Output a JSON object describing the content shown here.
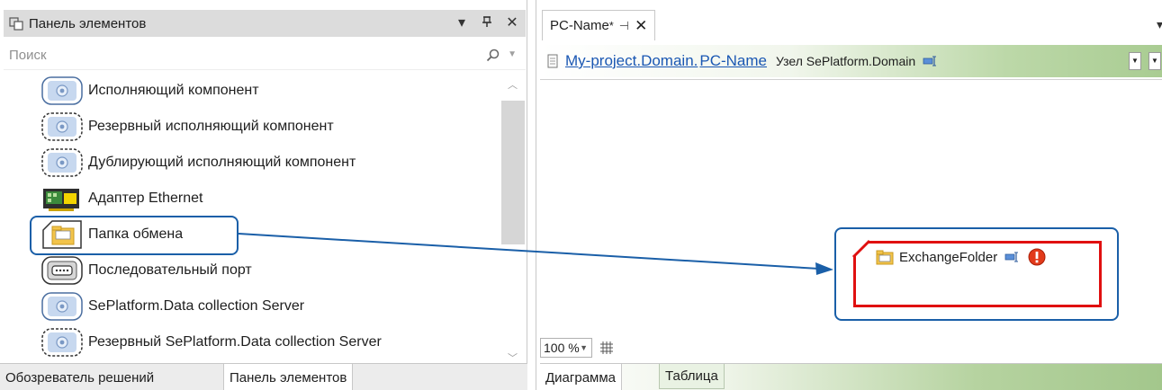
{
  "toolbox": {
    "title": "Панель элементов",
    "pin_glyph": "▾",
    "autohide_glyph": "ᵼ",
    "close_glyph": "✕",
    "search_placeholder": "Поиск",
    "items": [
      {
        "label": "Исполняющий компонент",
        "icon": "execution-component-icon"
      },
      {
        "label": "Резервный исполняющий компонент",
        "icon": "reserve-execution-component-icon"
      },
      {
        "label": "Дублирующий исполняющий компонент",
        "icon": "duplicate-execution-component-icon"
      },
      {
        "label": "Адаптер Ethernet",
        "icon": "ethernet-adapter-icon"
      },
      {
        "label": "Папка обмена",
        "icon": "exchange-folder-icon"
      },
      {
        "label": "Последовательный порт",
        "icon": "serial-port-icon"
      },
      {
        "label": "SePlatform.Data collection Server",
        "icon": "data-collection-server-icon"
      },
      {
        "label": "Резервный SePlatform.Data collection Server",
        "icon": "reserve-data-collection-server-icon"
      }
    ],
    "tabs": [
      "Обозреватель решений",
      "Панель элементов"
    ],
    "active_tab": "Панель элементов"
  },
  "document": {
    "tab_title": "PC-Name",
    "tab_modified_marker": "*",
    "tab_pin_glyph": "⊣",
    "tab_close_glyph": "✕",
    "breadcrumb": {
      "link1": "My-project.Domain.",
      "link2": "PC-Name",
      "type_label": "Узел SePlatform.Domain"
    },
    "zoom": "100 %",
    "bottom_tabs": [
      "Диаграмма",
      "Таблица"
    ],
    "active_bottom_tab": "Диаграмма"
  },
  "diagram_node": {
    "label": "ExchangeFolder",
    "status": "error",
    "status_glyph": "!"
  },
  "colors": {
    "highlight_blue": "#1a5fa8",
    "error_red": "#e01010",
    "link_blue": "#1a57b3",
    "green_gradient_end": "#a9cc92"
  }
}
